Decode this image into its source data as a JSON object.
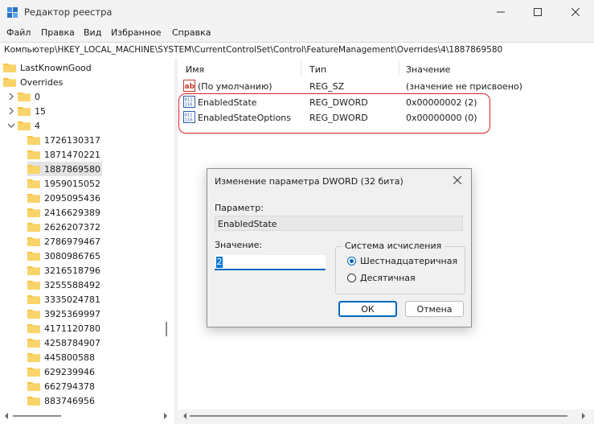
{
  "window": {
    "title": "Редактор реестра"
  },
  "menu": [
    "Файл",
    "Правка",
    "Вид",
    "Избранное",
    "Справка"
  ],
  "address": "Компьютер\\HKEY_LOCAL_MACHINE\\SYSTEM\\CurrentControlSet\\Control\\FeatureManagement\\Overrides\\4\\1887869580",
  "tree": {
    "top": [
      "LastKnownGood",
      "Overrides"
    ],
    "override_children": [
      "0",
      "15",
      "4"
    ],
    "keys": [
      "1726130317",
      "1871470221",
      "1887869580",
      "1959015052",
      "2095095436",
      "2416629389",
      "2626207372",
      "2786979467",
      "3080986765",
      "3216518796",
      "3255588492",
      "3335024781",
      "3925369997",
      "4171120780",
      "4258784907",
      "445800588",
      "629239946",
      "662794378",
      "883746956"
    ],
    "selected_key": "1887869580"
  },
  "list": {
    "columns": [
      "Имя",
      "Тип",
      "Значение"
    ],
    "rows": [
      {
        "icon": "string-value-icon",
        "name": "(По умолчанию)",
        "type": "REG_SZ",
        "value": "(значение не присвоено)"
      },
      {
        "icon": "dword-value-icon",
        "name": "EnabledState",
        "type": "REG_DWORD",
        "value": "0x00000002 (2)"
      },
      {
        "icon": "dword-value-icon",
        "name": "EnabledStateOptions",
        "type": "REG_DWORD",
        "value": "0x00000000 (0)"
      }
    ]
  },
  "dialog": {
    "title": "Изменение параметра DWORD (32 бита)",
    "param_label": "Параметр:",
    "param_value": "EnabledState",
    "value_label": "Значение:",
    "value": "2",
    "base_label": "Система исчисления",
    "base_options": [
      "Шестнадцатеричная",
      "Десятичная"
    ],
    "base_selected": "Шестнадцатеричная",
    "ok": "ОК",
    "cancel": "Отмена"
  },
  "colors": {
    "highlight": "#e0202a",
    "accent": "#0067c0",
    "folder": "#f6c343"
  }
}
